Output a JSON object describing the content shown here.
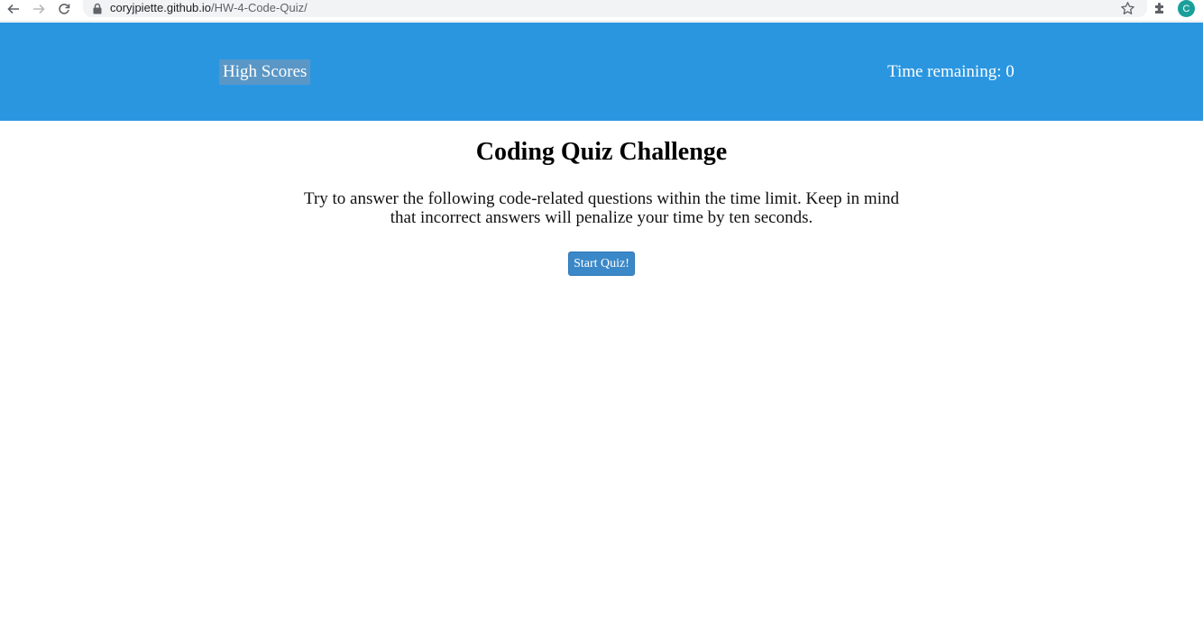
{
  "browser": {
    "url_host": "coryjpiette.github.io",
    "url_path": "/HW-4-Code-Quiz/",
    "profile_initial": "C",
    "icons": {
      "back": "arrow-left-icon",
      "forward": "arrow-right-icon",
      "reload": "reload-icon",
      "lock": "lock-icon",
      "bookmark": "star-icon",
      "extensions": "puzzle-icon"
    }
  },
  "header": {
    "high_scores_label": "High Scores",
    "timer_text": "Time remaining: 0",
    "background_color": "#2b96e0"
  },
  "main": {
    "title": "Coding Quiz Challenge",
    "intro": "Try to answer the following code-related questions within the time limit. Keep in mind that incorrect answers will penalize your time by ten seconds.",
    "start_button_label": "Start Quiz!"
  }
}
